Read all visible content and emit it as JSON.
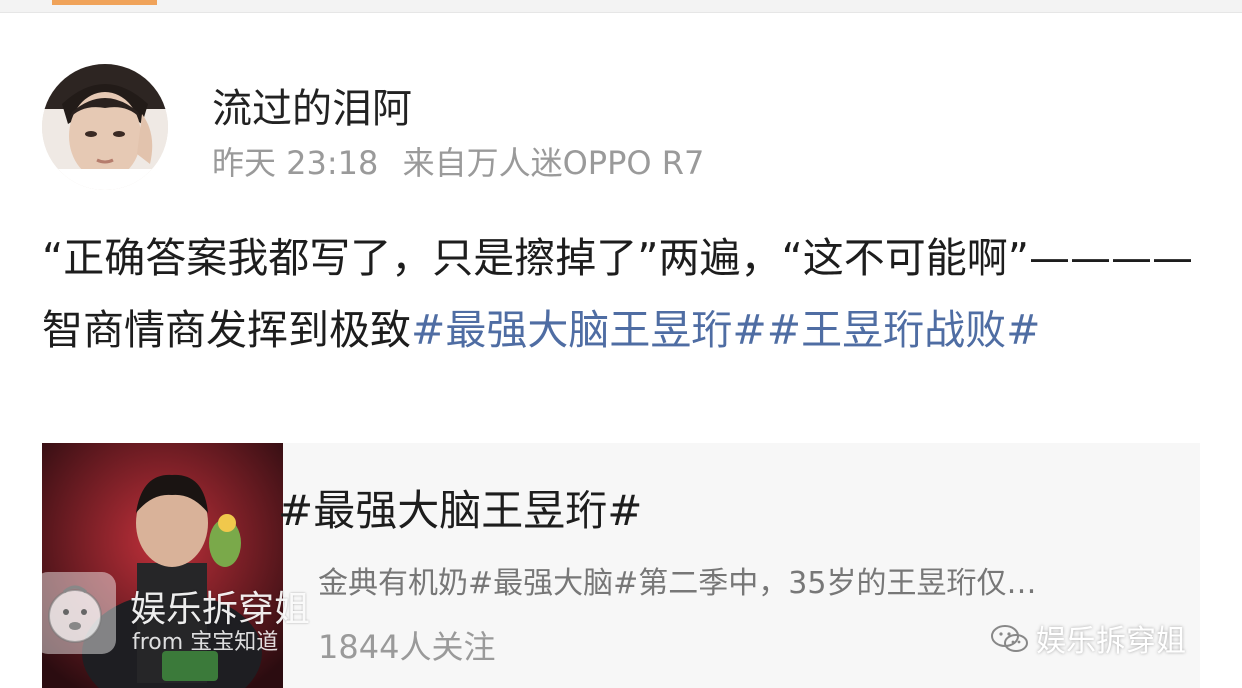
{
  "post": {
    "username": "流过的泪阿",
    "time": "昨天 23:18",
    "source": "来自万人迷OPPO R7",
    "text_main": "“正确答案我都写了，只是擦掉了”两遍，“这不可能啊”————智商情商发挥到极致",
    "hashtag_1": "#最强大脑王昱珩#",
    "hashtag_2": "#王昱珩战败#"
  },
  "topic_card": {
    "title": "#最强大脑王昱珩#",
    "description": "金典有机奶#最强大脑#第二季中，35岁的王昱珩仅…",
    "followers": "1844人关注"
  },
  "watermark": {
    "name": "娱乐拆穿姐",
    "from": "from 宝宝知道",
    "right_label": "娱乐拆穿姐"
  },
  "colors": {
    "hashtag": "#4f6da3",
    "meta": "#9a9a9a",
    "accent_tab": "#f0a35a"
  }
}
